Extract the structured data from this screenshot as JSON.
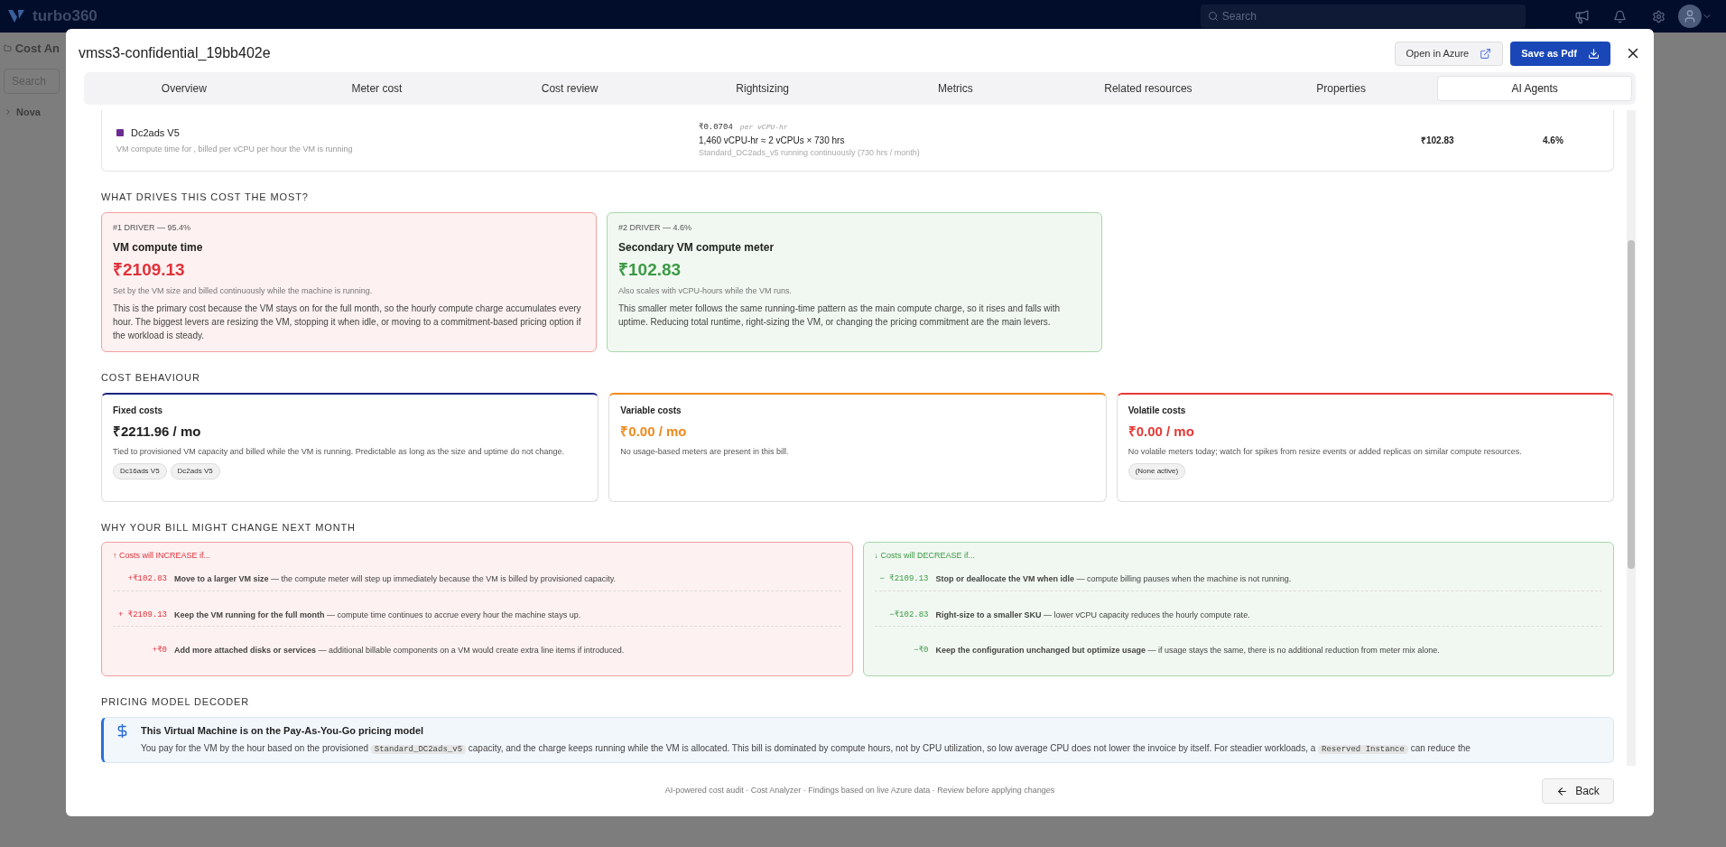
{
  "app": {
    "brand": "turbo360",
    "search_placeholder": "Search",
    "page_title": "Cost An",
    "sidebar_search": "Search",
    "tree_item": "Nova"
  },
  "modal": {
    "title": "vmss3-confidential_19bb402e",
    "actions": [
      {
        "label": "Open in Azure",
        "kind": "secondary"
      },
      {
        "label": "Save as Pdf",
        "kind": "primary"
      }
    ]
  },
  "tabs": [
    {
      "label": "Overview",
      "selected": false
    },
    {
      "label": "Meter cost",
      "selected": false
    },
    {
      "label": "Cost review",
      "selected": false
    },
    {
      "label": "Rightsizing",
      "selected": false
    },
    {
      "label": "Metrics",
      "selected": false
    },
    {
      "label": "Related resources",
      "selected": false
    },
    {
      "label": "Properties",
      "selected": false
    },
    {
      "label": "AI Agents",
      "selected": true
    }
  ],
  "meter_row": {
    "name": "Dc2ads V5",
    "color": "#6b2c91",
    "description": "VM compute time for , billed per vCPU per hour the VM is running",
    "rate": "₹0.0704",
    "rate_unit": "per vCPU-hr",
    "quantity": "1,460 vCPU-hr ≈ 2 vCPUs × 730 hrs",
    "usage_note": "Standard_DC2ads_v5 running continuously (730 hrs / month)",
    "cost": "₹102.83",
    "share": "4.6%"
  },
  "drivers": {
    "heading": "WHAT DRIVES THIS COST THE MOST?",
    "items": [
      {
        "kind": "primary",
        "rank": "#1 DRIVER — 95.4%",
        "title": "VM compute time",
        "amount": "₹2109.13",
        "summary": "Set by the VM size and billed continuously while the machine is running.",
        "detail": "This is the primary cost because the VM stays on for the full month, so the hourly compute charge accumulates every hour. The biggest levers are resizing the VM, stopping it when idle, or moving to a commitment-based pricing option if the workload is steady."
      },
      {
        "kind": "secondary",
        "rank": "#2 DRIVER — 4.6%",
        "title": "Secondary VM compute meter",
        "amount": "₹102.83",
        "summary": "Also scales with vCPU-hours while the VM runs.",
        "detail": "This smaller meter follows the same running-time pattern as the main compute charge, so it rises and falls with uptime. Reducing total runtime, right-sizing the VM, or changing the pricing commitment are the main levers."
      }
    ]
  },
  "cost_behaviour": {
    "heading": "COST BEHAVIOUR",
    "items": [
      {
        "kind": "fixed",
        "title": "Fixed costs",
        "amount": "₹2211.96 / mo",
        "description": "Tied to provisioned VM capacity and billed while the VM is running. Predictable as long as the size and uptime do not change.",
        "tags": [
          "Dc16ads V5",
          "Dc2ads V5"
        ]
      },
      {
        "kind": "variable",
        "title": "Variable costs",
        "amount": "₹0.00 / mo",
        "description": "No usage-based meters are present in this bill."
      },
      {
        "kind": "volatile",
        "title": "Volatile costs",
        "amount": "₹0.00 / mo",
        "description": "No volatile meters today; watch for spikes from resize events or added replicas on similar compute resources.",
        "tags": [
          "(None active)"
        ]
      }
    ]
  },
  "bill_change": {
    "heading": "WHY YOUR BILL MIGHT CHANGE NEXT MONTH",
    "groups": [
      {
        "kind": "increase",
        "title": "↑ Costs will INCREASE if...",
        "items": [
          {
            "delta": "+₹102.83",
            "text": "**Move to a larger VM size** — the compute meter will step up immediately because the VM is billed by provisioned capacity."
          },
          {
            "delta": "+ ₹2109.13",
            "text": "**Keep the VM running for the full month** — compute time continues to accrue every hour the machine stays up."
          },
          {
            "delta": "+₹0",
            "text": "**Add more attached disks or services** — additional billable components on a VM would create extra line items if introduced."
          }
        ]
      },
      {
        "kind": "decrease",
        "title": "↓ Costs will DECREASE if...",
        "items": [
          {
            "delta": "− ₹2109.13",
            "text": "**Stop or deallocate the VM when idle** — compute billing pauses when the machine is not running."
          },
          {
            "delta": "−₹102.83",
            "text": "**Right-size to a smaller SKU** — lower vCPU capacity reduces the hourly compute rate."
          },
          {
            "delta": "−₹0",
            "text": "**Keep the configuration unchanged but optimize usage** — if usage stays the same, there is no additional reduction from meter mix alone."
          }
        ]
      }
    ]
  },
  "pricing": {
    "heading": "PRICING MODEL DECODER",
    "title": "This Virtual Machine is on the Pay-As-You-Go pricing model",
    "parts": [
      {
        "kind": "text",
        "text": "You pay for the VM by the hour based on the provisioned "
      },
      {
        "kind": "code",
        "text": "Standard_DC2ads_v5"
      },
      {
        "kind": "text",
        "text": " capacity, and the charge keeps running while the VM is allocated. This bill is dominated by compute hours, not by CPU utilization, so low average CPU does not lower the invoice by itself. For steadier workloads, a "
      },
      {
        "kind": "code",
        "text": "Reserved Instance"
      },
      {
        "kind": "text",
        "text": " can reduce the"
      }
    ]
  },
  "footer": {
    "note": "AI-powered cost audit · Cost Analyzer · Findings based on live Azure data · Review before applying changes",
    "back": "Back"
  }
}
